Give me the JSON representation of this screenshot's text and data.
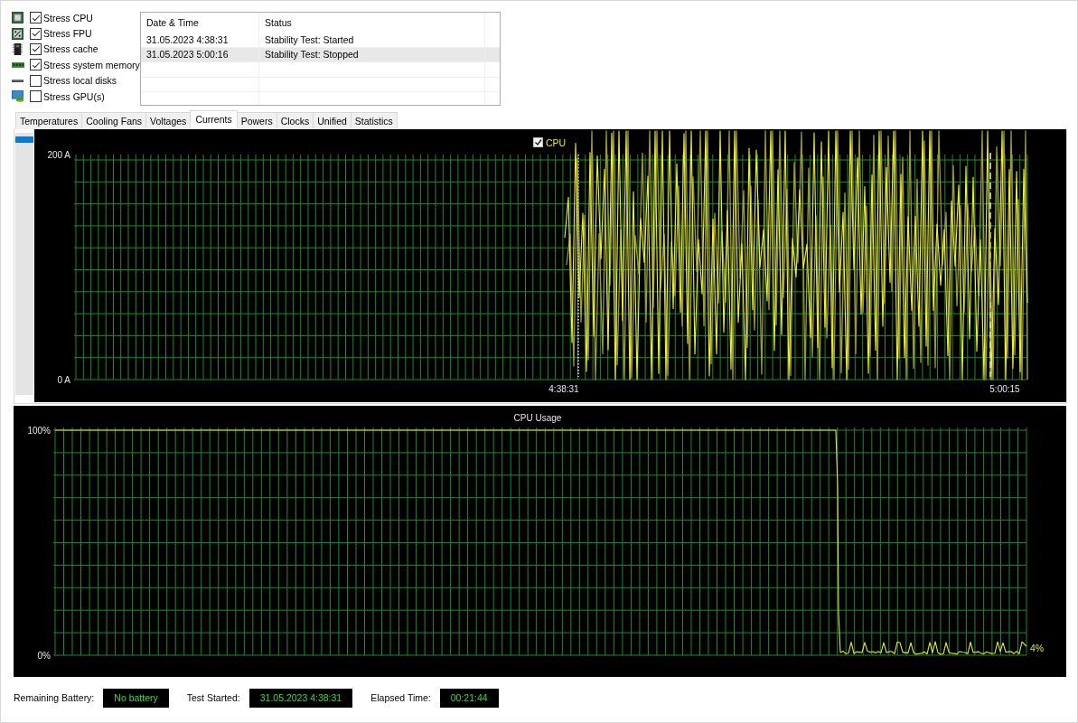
{
  "stress_options": [
    {
      "kind": "cpu",
      "label": "Stress CPU",
      "checked": true
    },
    {
      "kind": "fpu",
      "label": "Stress FPU",
      "checked": true
    },
    {
      "kind": "cache",
      "label": "Stress cache",
      "checked": true
    },
    {
      "kind": "memory",
      "label": "Stress system memory",
      "checked": true
    },
    {
      "kind": "disk",
      "label": "Stress local disks",
      "checked": false
    },
    {
      "kind": "gpu",
      "label": "Stress GPU(s)",
      "checked": false
    }
  ],
  "log": {
    "columns": [
      "Date & Time",
      "Status"
    ],
    "rows": [
      {
        "cells": [
          "31.05.2023 4:38:31",
          "Stability Test: Started"
        ],
        "selected": false
      },
      {
        "cells": [
          "31.05.2023 5:00:16",
          "Stability Test: Stopped"
        ],
        "selected": true
      }
    ]
  },
  "tabs": [
    {
      "label": "Temperatures",
      "selected": false
    },
    {
      "label": "Cooling Fans",
      "selected": false
    },
    {
      "label": "Voltages",
      "selected": false
    },
    {
      "label": "Currents",
      "selected": true
    },
    {
      "label": "Powers",
      "selected": false
    },
    {
      "label": "Clocks",
      "selected": false
    },
    {
      "label": "Unified",
      "selected": false
    },
    {
      "label": "Statistics",
      "selected": false
    }
  ],
  "currents_chart": {
    "legend": {
      "label": "CPU",
      "checked": true
    },
    "y_labels": [
      "200 A",
      "0 A"
    ],
    "x_labels": [
      "4:38:31",
      "5:00:15"
    ]
  },
  "usage_chart": {
    "title": "CPU Usage",
    "y_labels": [
      "100%",
      "0%"
    ],
    "reading": "4%"
  },
  "status_bar": [
    {
      "label": "Remaining Battery:",
      "value": "No battery"
    },
    {
      "label": "Test Started:",
      "value": "31.05.2023 4:38:31"
    },
    {
      "label": "Elapsed Time:",
      "value": "00:21:44"
    }
  ]
}
